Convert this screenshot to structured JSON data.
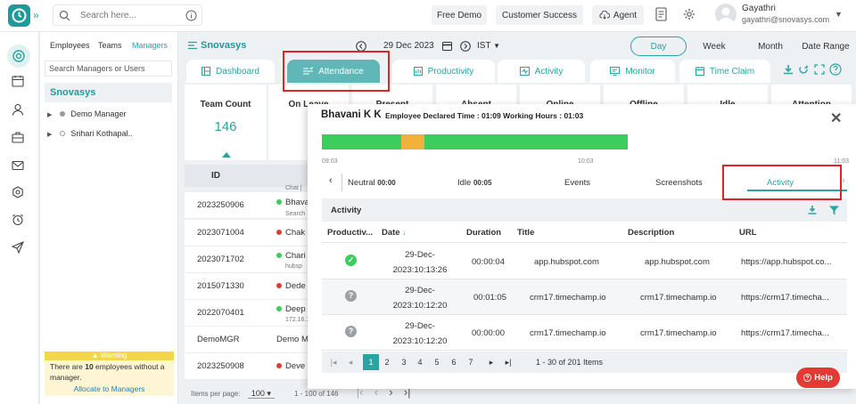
{
  "topbar": {
    "search_placeholder": "Search here...",
    "free_demo": "Free Demo",
    "customer_success": "Customer Success",
    "agent": "Agent",
    "user_name": "Gayathri",
    "user_email": "gayathri@snovasys.com"
  },
  "filter_panel": {
    "tabs": [
      "Employees",
      "Teams",
      "Managers"
    ],
    "search_placeholder": "Search Managers or Users",
    "org_name": "Snovasys",
    "tree": [
      "Demo Manager",
      "Srihari Kothapal.."
    ],
    "warning_title": "Warning",
    "warning_pre": "There are ",
    "warning_count": "10",
    "warning_post": " employees without a manager.",
    "warning_link": "Allocate to Managers"
  },
  "header": {
    "brand": "Snovasys",
    "date": "29 Dec 2023",
    "timezone": "IST",
    "ranges": [
      "Day",
      "Week",
      "Month",
      "Date Range"
    ]
  },
  "tabs": [
    "Dashboard",
    "Attendance",
    "Productivity",
    "Activity",
    "Monitor",
    "Time Claim"
  ],
  "stats": {
    "labels": [
      "Team Count",
      "On Leave",
      "Present",
      "Absent",
      "Online",
      "Offline",
      "Idle",
      "Attention"
    ],
    "team_count": "146"
  },
  "left_table": {
    "header": "ID",
    "rows": [
      {
        "id": "2023250906",
        "name": "Bhava",
        "sub": "Search",
        "top": "Chat |"
      },
      {
        "id": "2023071004",
        "name": "Chak",
        "sub": "",
        "top": ""
      },
      {
        "id": "2023071702",
        "name": "Chari",
        "sub": "hubsp",
        "top": ""
      },
      {
        "id": "2015071330",
        "name": "Dede",
        "sub": "",
        "top": ""
      },
      {
        "id": "2022070401",
        "name": "Deep",
        "sub": "172.16.1",
        "top": ""
      },
      {
        "id": "DemoMGR",
        "name": "Demo M",
        "sub": "",
        "top": ""
      },
      {
        "id": "2023250908",
        "name": "Deve",
        "sub": "",
        "top": ""
      }
    ],
    "items_per_page_label": "Items per page:",
    "items_per_page": "100",
    "range": "1 - 100 of 146"
  },
  "modal": {
    "employee": "Bhavani K K",
    "declared": "Employee Declared Time : 01:09  Working Hours : 01:03",
    "timeline_ticks": [
      "09:03",
      "10:03",
      "11:03"
    ],
    "subtabs": {
      "neutral_label": "Neutral",
      "neutral_value": "00:00",
      "idle_label": "Idle",
      "idle_value": "00:05",
      "events": "Events",
      "screenshots": "Screenshots",
      "activity": "Activity"
    },
    "section_title": "Activity",
    "columns": [
      "Productiv...",
      "Date",
      "Duration",
      "Title",
      "Description",
      "URL"
    ],
    "rows": [
      {
        "status": "productive",
        "date": "29-Dec-2023:10:13:26",
        "duration": "00:00:04",
        "title": "app.hubspot.com",
        "description": "app.hubspot.com",
        "url": "https://app.hubspot.co..."
      },
      {
        "status": "neutral",
        "date": "29-Dec-2023:10:12:20",
        "duration": "00:01:05",
        "title": "crm17.timechamp.io",
        "description": "crm17.timechamp.io",
        "url": "https://crm17.timecha..."
      },
      {
        "status": "neutral",
        "date": "29-Dec-2023:10:12:20",
        "duration": "00:00:00",
        "title": "crm17.timechamp.io",
        "description": "crm17.timechamp.io",
        "url": "https://crm17.timecha..."
      }
    ],
    "pages": [
      "1",
      "2",
      "3",
      "4",
      "5",
      "6",
      "7"
    ],
    "current_page": "1",
    "items_summary": "1 - 30 of 201 Items"
  },
  "help": "Help",
  "colors": {
    "accent": "#2aa3a3",
    "productive": "#3dcd5c",
    "idle": "#f0b23b",
    "highlight": "#e02424"
  }
}
